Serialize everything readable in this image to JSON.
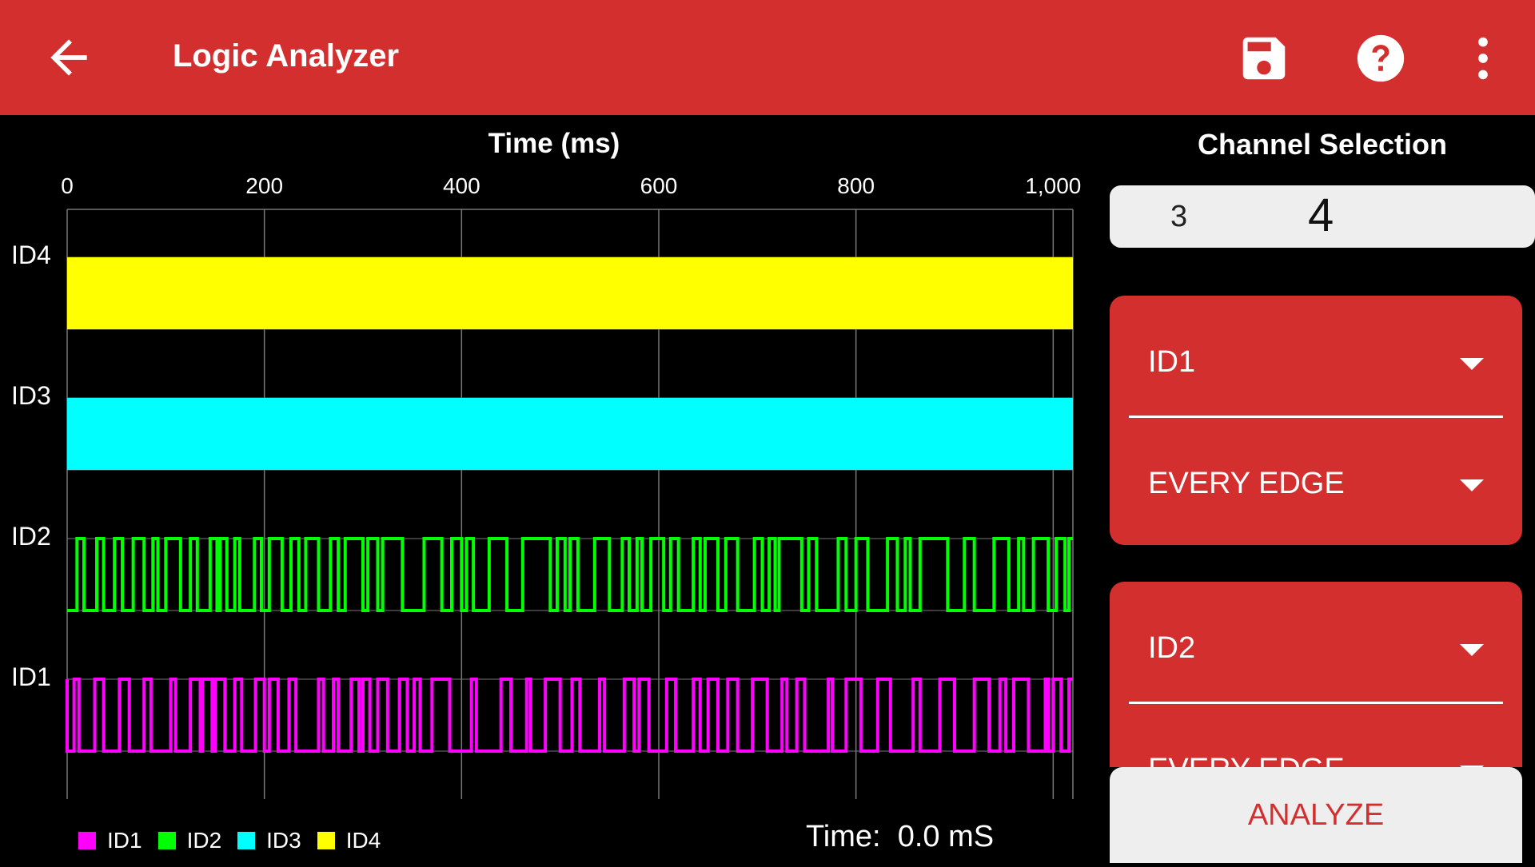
{
  "appbar": {
    "title": "Logic Analyzer",
    "color": "#d32f2f"
  },
  "chart_data": {
    "type": "line",
    "title": "",
    "xlabel": "Time (ms)",
    "ylabel": "",
    "xlim": [
      0,
      1020
    ],
    "xticks": [
      0,
      200,
      400,
      600,
      800,
      1000
    ],
    "xtick_labels": [
      "0",
      "200",
      "400",
      "600",
      "800",
      "1,000"
    ],
    "channels": [
      "ID4",
      "ID3",
      "ID2",
      "ID1"
    ],
    "grid": true,
    "legend_position": "bottom-left",
    "series": [
      {
        "name": "ID1",
        "color": "#ff00ff",
        "edges_ms": [
          0,
          7,
          12,
          28,
          37,
          53,
          63,
          78,
          85,
          105,
          110,
          125,
          135,
          137,
          147,
          150,
          160,
          170,
          177,
          191,
          200,
          205,
          214,
          225,
          232,
          255,
          260,
          270,
          275,
          288,
          296,
          300,
          307,
          315,
          325,
          337,
          345,
          352,
          358,
          370,
          388,
          410,
          415,
          440,
          450,
          466,
          470,
          485,
          500,
          512,
          520,
          540,
          545,
          565,
          575,
          580,
          590,
          608,
          617,
          635,
          642,
          650,
          660,
          670,
          680,
          695,
          710,
          725,
          730,
          740,
          748,
          772,
          776,
          790,
          805,
          822,
          835,
          858,
          865,
          885,
          900,
          920,
          935,
          946,
          952,
          960,
          975,
          992,
          995,
          1000,
          1008,
          1016
        ],
        "start_level": 1
      },
      {
        "name": "ID2",
        "color": "#00ff00",
        "edges_ms": [
          10,
          17,
          30,
          37,
          48,
          56,
          67,
          78,
          87,
          92,
          100,
          115,
          125,
          132,
          145,
          152,
          155,
          162,
          170,
          175,
          190,
          197,
          205,
          218,
          227,
          235,
          242,
          255,
          267,
          275,
          282,
          300,
          305,
          315,
          320,
          340,
          362,
          380,
          390,
          400,
          405,
          412,
          428,
          446,
          462,
          490,
          497,
          505,
          510,
          518,
          535,
          550,
          563,
          570,
          578,
          583,
          592,
          605,
          612,
          620,
          635,
          642,
          647,
          660,
          668,
          680,
          697,
          705,
          712,
          718,
          722,
          745,
          752,
          760,
          782,
          790,
          800,
          812,
          832,
          842,
          850,
          855,
          865,
          893,
          910,
          920,
          940,
          955,
          965,
          970,
          980,
          995,
          1003,
          1012,
          1016
        ],
        "start_level": 0
      },
      {
        "name": "ID3",
        "color": "#00ffff",
        "style": "dense"
      },
      {
        "name": "ID4",
        "color": "#ffff00",
        "style": "dense"
      }
    ]
  },
  "legend": [
    {
      "label": "ID1",
      "color": "#ff00ff"
    },
    {
      "label": "ID2",
      "color": "#00ff00"
    },
    {
      "label": "ID3",
      "color": "#00ffff"
    },
    {
      "label": "ID4",
      "color": "#ffff00"
    }
  ],
  "readout": {
    "prefix": "Time:",
    "value": "0.0 mS"
  },
  "sidebar": {
    "title": "Channel Selection",
    "picker": {
      "previous": "3",
      "current": "4"
    },
    "group1": {
      "channel": "ID1",
      "edge": "EVERY EDGE"
    },
    "group2": {
      "channel": "ID2",
      "edge": "EVERY EDGE"
    },
    "analyze_label": "ANALYZE"
  },
  "icons": {
    "back": "arrow-back-icon",
    "save": "save-icon",
    "help": "help-icon",
    "more": "more-vert-icon"
  }
}
